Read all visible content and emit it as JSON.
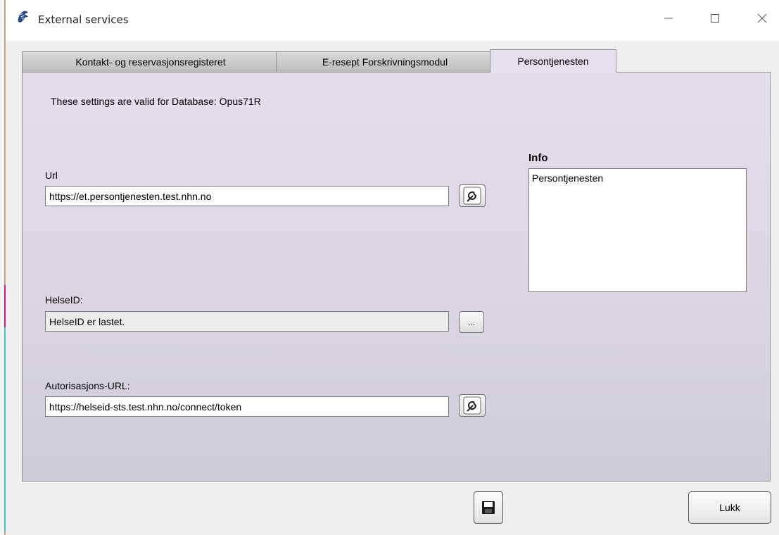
{
  "window": {
    "title": "External services"
  },
  "tabs": [
    {
      "label": "Kontakt- og reservasjonsregisteret",
      "active": false
    },
    {
      "label": "E-resept Forskrivningsmodul",
      "active": false
    },
    {
      "label": "Persontjenesten",
      "active": true
    }
  ],
  "panel": {
    "db_note": "These settings are valid for Database: Opus71R",
    "url": {
      "label": "Url",
      "value": "https://et.persontjenesten.test.nhn.no"
    },
    "helseid": {
      "label": "HelseID:",
      "value": "HelseID er lastet.",
      "button_label": "..."
    },
    "auth": {
      "label": "Autorisasjons-URL:",
      "value": "https://helseid-sts.test.nhn.no/connect/token"
    },
    "info": {
      "title": "Info",
      "text": "Persontjenesten"
    }
  },
  "footer": {
    "close_label": "Lukk"
  },
  "icons": {
    "app": "app-logo-icon",
    "url_button": "wrench-icon",
    "auth_button": "wrench-icon",
    "save": "save-icon"
  }
}
